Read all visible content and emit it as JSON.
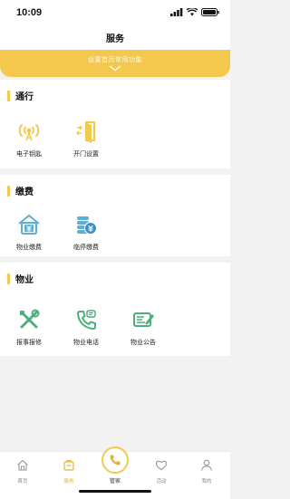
{
  "status": {
    "time": "10:09"
  },
  "header": {
    "title": "服务"
  },
  "banner": {
    "text": "设置首页常用功能"
  },
  "sections": [
    {
      "title": "通行",
      "items": [
        {
          "label": "电子钥匙",
          "icon": "signal-key-icon"
        },
        {
          "label": "开门设置",
          "icon": "door-icon"
        }
      ]
    },
    {
      "title": "缴费",
      "items": [
        {
          "label": "物业缴费",
          "icon": "house-yen-icon"
        },
        {
          "label": "临停缴费",
          "icon": "coins-yen-icon"
        }
      ]
    },
    {
      "title": "物业",
      "items": [
        {
          "label": "报事报修",
          "icon": "tools-icon"
        },
        {
          "label": "物业电话",
          "icon": "phone-icon"
        },
        {
          "label": "物业公告",
          "icon": "notice-icon"
        }
      ]
    }
  ],
  "tabbar": {
    "items": [
      {
        "label": "首页"
      },
      {
        "label": "服务"
      },
      {
        "label": "管家"
      },
      {
        "label": "活动"
      },
      {
        "label": "我的"
      }
    ]
  },
  "colors": {
    "accent": "#f2c94c",
    "blue": "#5aaed8",
    "green": "#4caf7d"
  }
}
